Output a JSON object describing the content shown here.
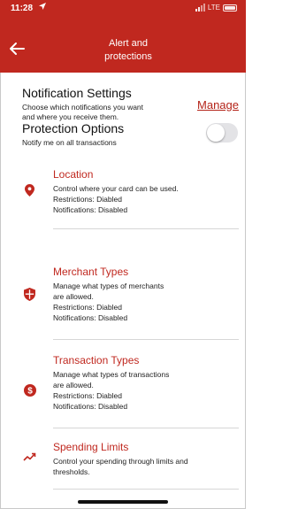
{
  "status_bar": {
    "time": "11:28",
    "network": "LTE"
  },
  "header": {
    "title_line1": "Alert and",
    "title_line2": "protections"
  },
  "notification_settings": {
    "title": "Notification Settings",
    "desc_line1": "Choose which notifications you want",
    "desc_line2": "and where you receive them.",
    "action": "Manage"
  },
  "protection_options": {
    "title": "Protection Options",
    "desc": "Notify me on all transactions",
    "enabled": false
  },
  "items": [
    {
      "name": "Location",
      "line1": "Control where your card can be used.",
      "line2": "Restrictions: Diabled",
      "line3": "Notifications: Disabled",
      "icon": "location-pin-icon"
    },
    {
      "name": "Merchant Types",
      "line1": "Manage what types of merchants",
      "line2": "are allowed.",
      "line3": "Restrictions: Diabled",
      "line4": "Notifications: Disabled",
      "icon": "shield-icon"
    },
    {
      "name": "Transaction Types",
      "line1": "Manage what types of transactions",
      "line2": "are allowed.",
      "line3": "Restrictions: Diabled",
      "line4": "Notifications: Disabled",
      "icon": "dollar-circle-icon"
    },
    {
      "name": "Spending Limits",
      "line1": "Control your spending through limits and",
      "line2": "thresholds.",
      "icon": "trend-up-icon"
    }
  ],
  "colors": {
    "brand_red": "#c0281f",
    "link_red": "#b42318",
    "toggle_off": "#e3e3e6"
  }
}
